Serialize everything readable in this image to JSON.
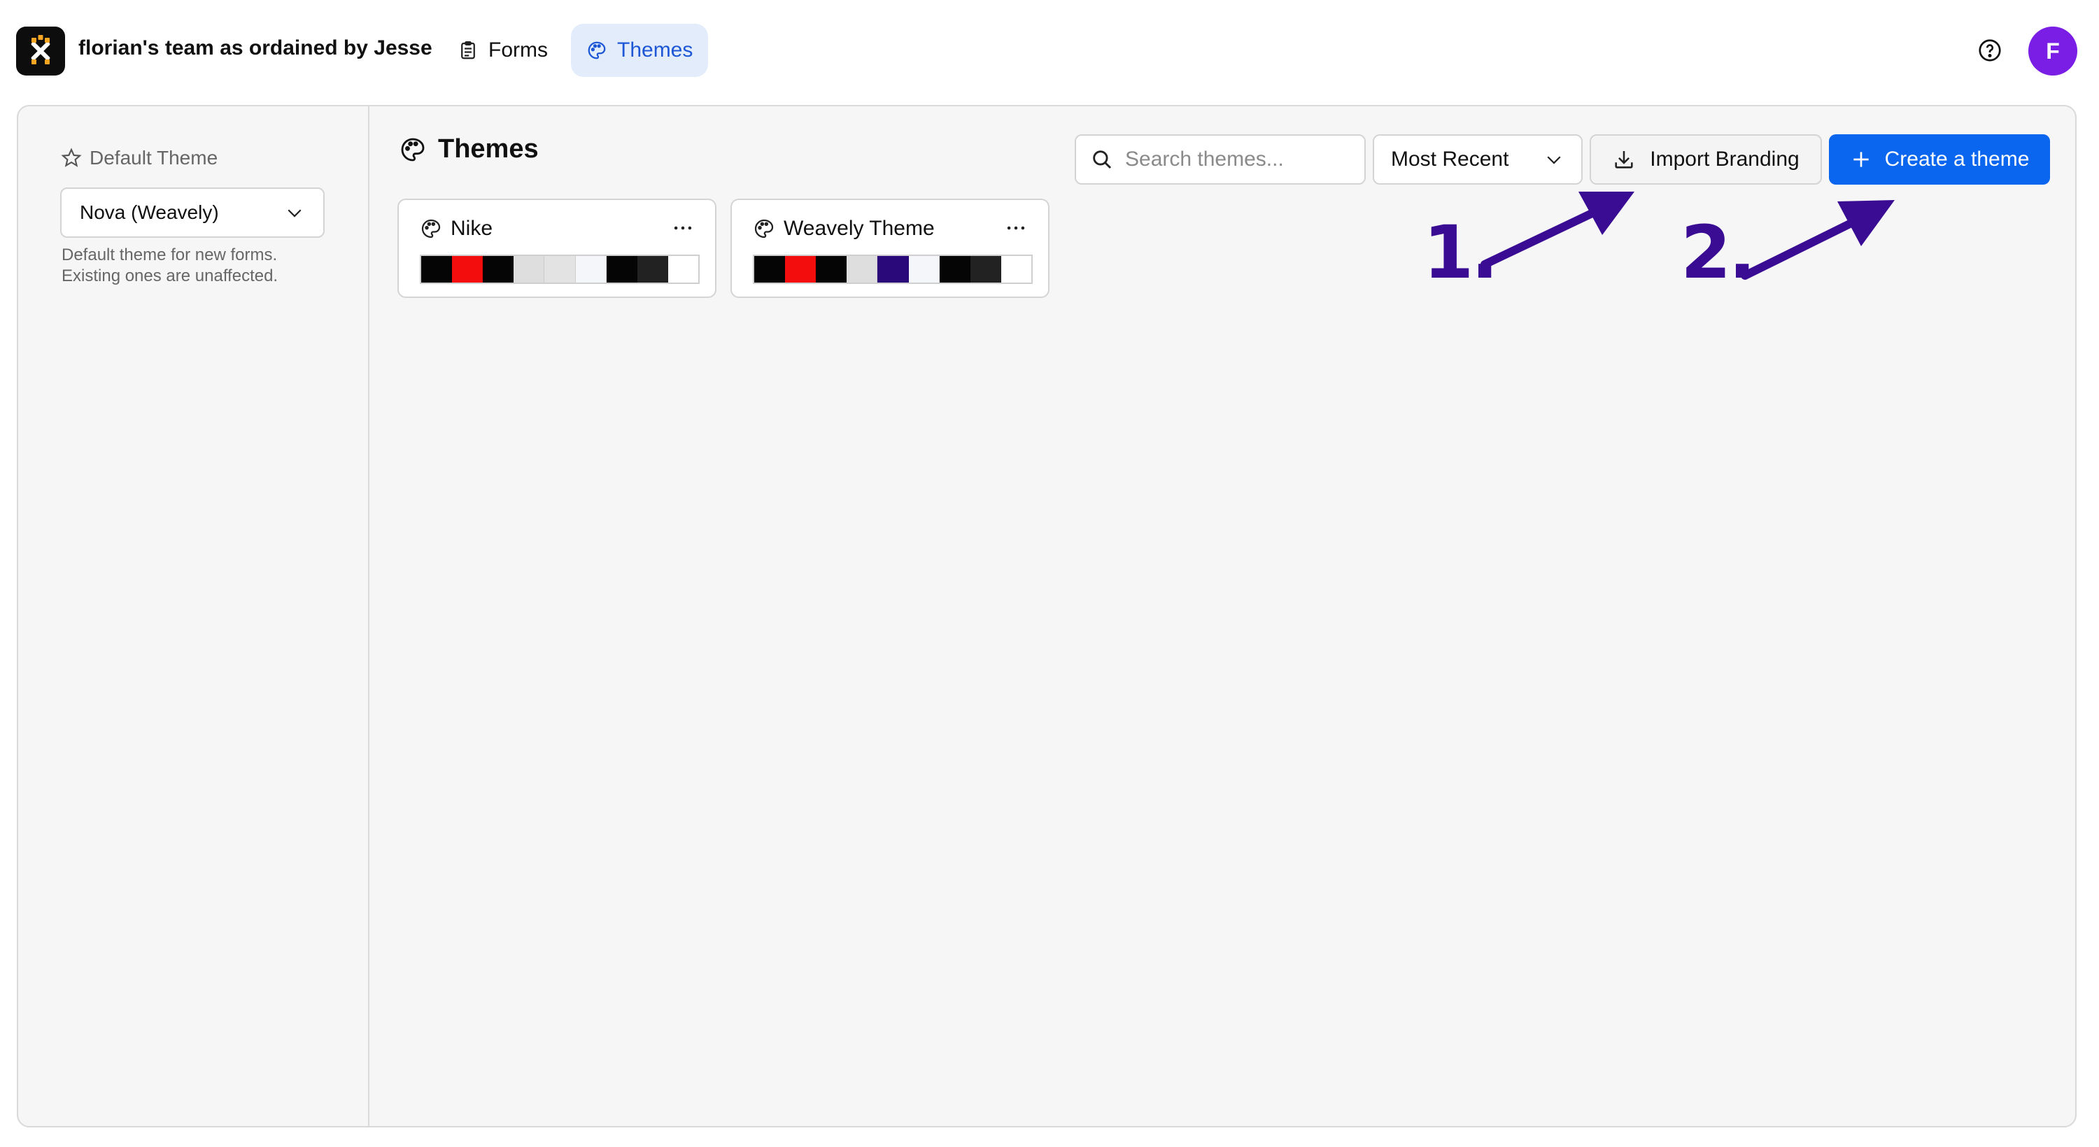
{
  "topbar": {
    "team_name": "florian's team as ordained by Jesse",
    "nav": [
      {
        "label": "Forms",
        "icon": "clipboard-icon"
      },
      {
        "label": "Themes",
        "icon": "palette-icon",
        "active": true
      }
    ],
    "avatar_initial": "F"
  },
  "sidebar": {
    "default_label": "Default Theme",
    "default_value": "Nova (Weavely)",
    "help_line1": "Default theme for new forms.",
    "help_line2": "Existing ones are unaffected."
  },
  "content": {
    "title": "Themes",
    "search_placeholder": "Search themes...",
    "sort_value": "Most Recent",
    "import_label": "Import Branding",
    "create_label": "Create a theme"
  },
  "themes": [
    {
      "name": "Nike",
      "swatches": [
        "#050505",
        "#f40d0d",
        "#050505",
        "#dedede",
        "#e3e3e3",
        "#f4f6f9",
        "#050505",
        "#222222",
        "#ffffff"
      ]
    },
    {
      "name": "Weavely Theme",
      "swatches": [
        "#050505",
        "#f40d0d",
        "#050505",
        "#dedede",
        "#2a0a7a",
        "#f4f6f9",
        "#050505",
        "#222222",
        "#ffffff"
      ]
    }
  ],
  "annotations": {
    "step1": "1.",
    "step2": "2.",
    "color": "#3a0c94"
  },
  "colors": {
    "accent": "#0a66ee",
    "active_tab_bg": "#e3ecfb",
    "active_tab_text": "#1d57d6",
    "avatar": "#7a1ee6"
  }
}
